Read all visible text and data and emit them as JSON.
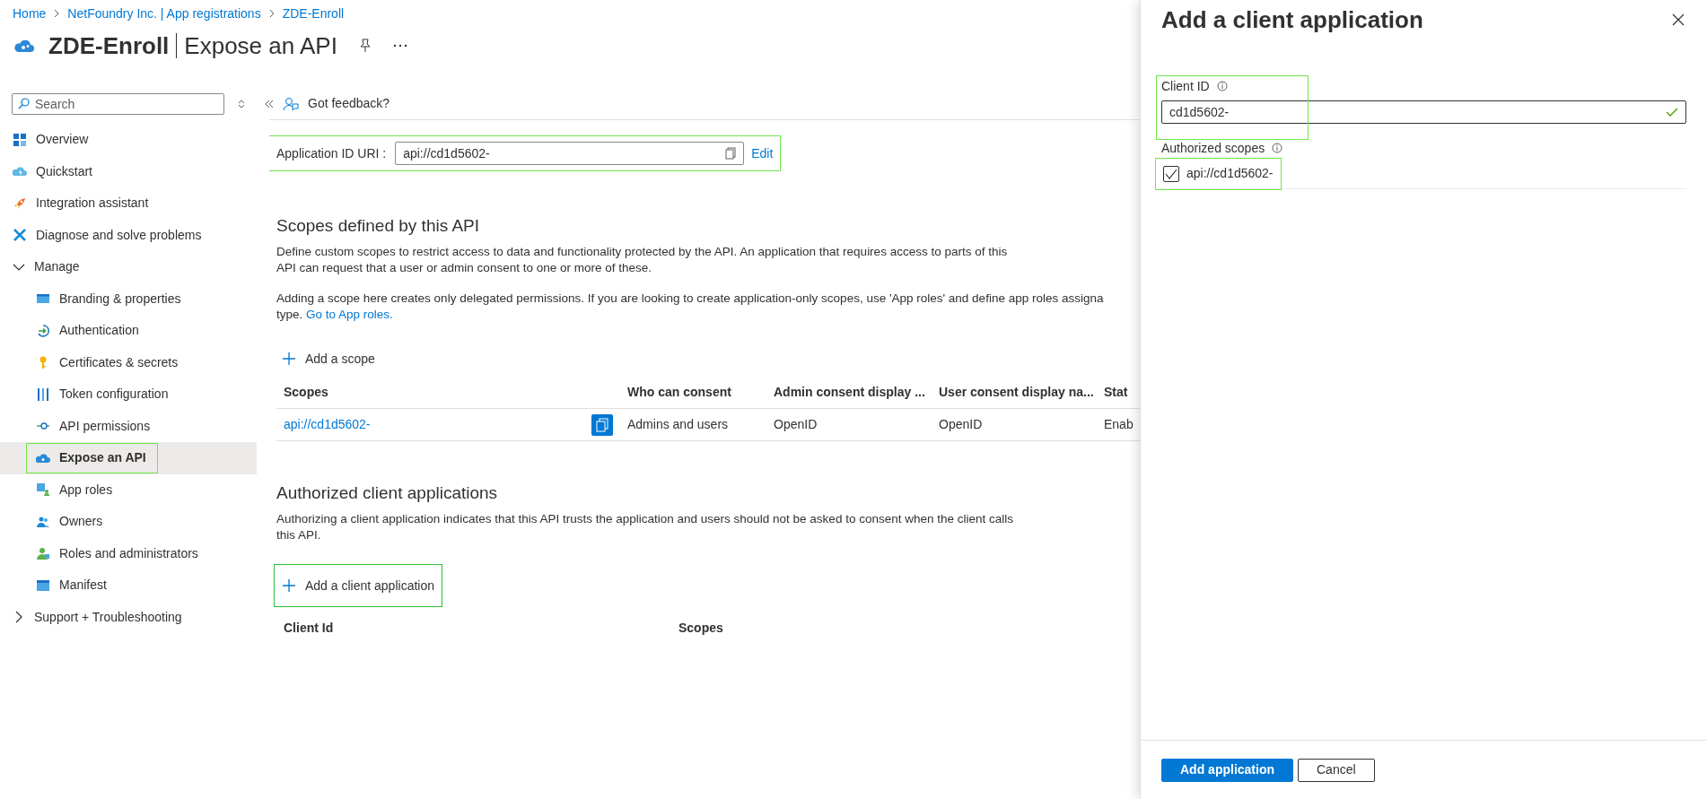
{
  "breadcrumb": [
    "Home",
    "NetFoundry Inc. | App registrations",
    "ZDE-Enroll"
  ],
  "page_title": {
    "app": "ZDE-Enroll",
    "section": "Expose an API"
  },
  "sidebar": {
    "search": {
      "placeholder": "Search"
    },
    "items": [
      {
        "label": "Overview",
        "selected": false,
        "highlighted": false
      },
      {
        "label": "Quickstart",
        "selected": false,
        "highlighted": false
      },
      {
        "label": "Integration assistant",
        "selected": false,
        "highlighted": false
      },
      {
        "label": "Diagnose and solve problems",
        "selected": false,
        "highlighted": false
      },
      {
        "label": "Manage",
        "expanded": true,
        "children": [
          {
            "label": "Branding & properties",
            "selected": false,
            "highlighted": false
          },
          {
            "label": "Authentication",
            "selected": false,
            "highlighted": false
          },
          {
            "label": "Certificates & secrets",
            "selected": false,
            "highlighted": false
          },
          {
            "label": "Token configuration",
            "selected": false,
            "highlighted": false
          },
          {
            "label": "API permissions",
            "selected": false,
            "highlighted": false
          },
          {
            "label": "Expose an API",
            "selected": true,
            "highlighted": true
          },
          {
            "label": "App roles",
            "selected": false,
            "highlighted": false
          },
          {
            "label": "Owners",
            "selected": false,
            "highlighted": false
          },
          {
            "label": "Roles and administrators",
            "selected": false,
            "highlighted": false
          },
          {
            "label": "Manifest",
            "selected": false,
            "highlighted": false
          }
        ]
      },
      {
        "label": "Support + Troubleshooting",
        "expanded": false
      }
    ]
  },
  "toolbar": {
    "feedback": "Got feedback?"
  },
  "app_id_uri": {
    "label": "Application ID URI :",
    "value": "api://cd1d5602-",
    "edit": "Edit",
    "highlighted": true
  },
  "scopes_section": {
    "heading": "Scopes defined by this API",
    "description": [
      "Define custom scopes to restrict access to data and functionality protected by the API. An application that requires access to parts of this",
      "API can request that a user or admin consent to one or more of these."
    ],
    "note": [
      "Adding a scope here creates only delegated permissions. If you are looking to create application-only scopes, use 'App roles' and define app roles assigna",
      "type."
    ],
    "note_link": "Go to App roles.",
    "add_button": "Add a scope",
    "table": {
      "columns": [
        "Scopes",
        "Who can consent",
        "Admin consent display ...",
        "User consent display na...",
        "Stat"
      ],
      "rows": [
        [
          "api://cd1d5602-",
          "Admins and users",
          "OpenID",
          "OpenID",
          "Enab"
        ]
      ]
    }
  },
  "clients_section": {
    "heading": "Authorized client applications",
    "description": [
      "Authorizing a client application indicates that this API trusts the application and users should not be asked to consent when the client calls",
      "this API."
    ],
    "add_button": {
      "label": "Add a client application",
      "highlighted": true
    },
    "table": {
      "columns": [
        "Client Id",
        "Scopes"
      ]
    }
  },
  "panel": {
    "title": "Add a client application",
    "client_id": {
      "label": "Client ID",
      "value": "cd1d5602-",
      "valid": true,
      "highlighted": true
    },
    "scopes_label": "Authorized scopes",
    "scopes": [
      {
        "label": "api://cd1d5602-",
        "checked": true,
        "highlighted": true
      }
    ],
    "buttons": [
      {
        "label": "Add application",
        "kind": "primary"
      },
      {
        "label": "Cancel",
        "kind": "secondary"
      }
    ]
  }
}
